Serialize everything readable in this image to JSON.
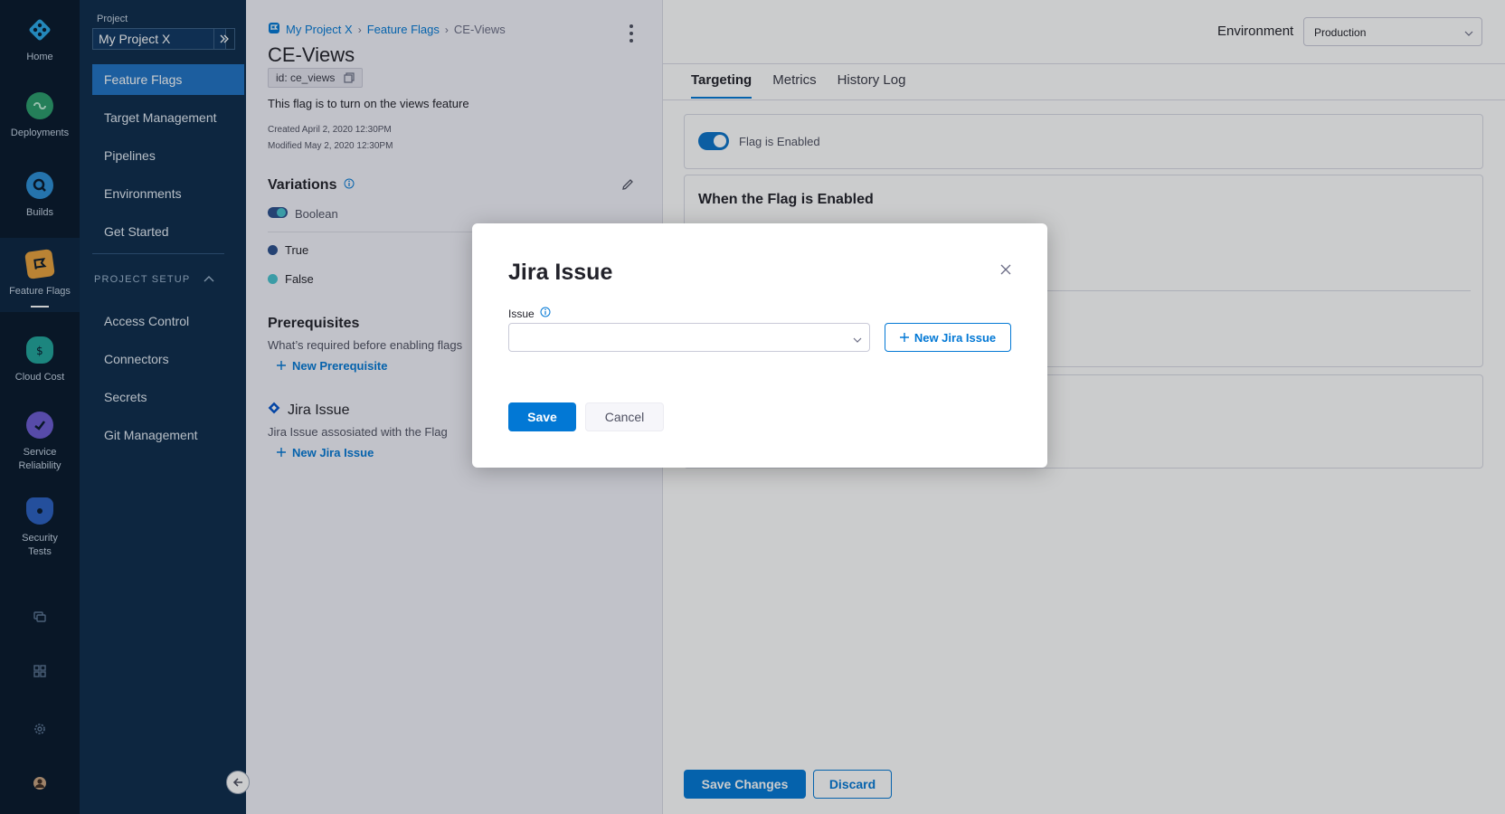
{
  "rail": {
    "items": [
      {
        "label": "Home",
        "icon": "home-icon"
      },
      {
        "label": "Deployments",
        "icon": "deployments-icon"
      },
      {
        "label": "Builds",
        "icon": "builds-icon"
      },
      {
        "label": "Feature Flags",
        "icon": "feature-flags-icon"
      },
      {
        "label": "Cloud Cost",
        "icon": "cloud-cost-icon"
      },
      {
        "label": "Service\nReliability",
        "icon": "service-reliability-icon"
      },
      {
        "label": "Security\nTests",
        "icon": "security-tests-icon"
      }
    ],
    "active": "Feature Flags",
    "bottom_icons": [
      "chat-icon",
      "grid-icon",
      "settings-icon",
      "user-avatar-icon"
    ]
  },
  "project_nav": {
    "project_label": "Project",
    "project_name": "My Project X",
    "items": [
      "Feature Flags",
      "Target Management",
      "Pipelines",
      "Environments",
      "Get Started"
    ],
    "active": "Feature Flags",
    "section_title": "PROJECT SETUP",
    "setup_items": [
      "Access Control",
      "Connectors",
      "Secrets",
      "Git Management"
    ]
  },
  "details": {
    "breadcrumb": [
      "My Project X",
      "Feature Flags",
      "CE-Views"
    ],
    "title": "CE-Views",
    "id_label": "id: ce_views",
    "description": "This flag is to turn on the views feature",
    "created": "Created April 2, 2020 12:30PM",
    "modified": "Modified May 2, 2020 12:30PM",
    "variations": {
      "title": "Variations",
      "type": "Boolean",
      "items": [
        {
          "label": "True",
          "color": "#2b4f8c"
        },
        {
          "label": "False",
          "color": "#47c2ce"
        }
      ]
    },
    "prerequisites": {
      "title": "Prerequisites",
      "subtitle": "What’s required before enabling flags",
      "add_label": "New Prerequisite"
    },
    "jira": {
      "title": "Jira Issue",
      "subtitle": "Jira Issue assosiated with the Flag",
      "add_label": "New Jira Issue"
    }
  },
  "main": {
    "environment_label": "Environment",
    "environment_value": "Production",
    "tabs": [
      "Targeting",
      "Metrics",
      "History Log"
    ],
    "active_tab": "Targeting",
    "flag_toggle_label": "Flag is Enabled",
    "flag_enabled": true,
    "when_enabled_title": "When the Flag is Enabled",
    "save_changes_label": "Save Changes",
    "discard_label": "Discard"
  },
  "dialog": {
    "title": "Jira Issue",
    "issue_label": "Issue",
    "issue_value": "",
    "new_issue_label": "New Jira Issue",
    "save_label": "Save",
    "cancel_label": "Cancel"
  },
  "colors": {
    "accent": "#0278d5",
    "rail_bg": "#07182b",
    "nav_bg": "#0c2b4b",
    "nav_active": "#1f73c4"
  }
}
